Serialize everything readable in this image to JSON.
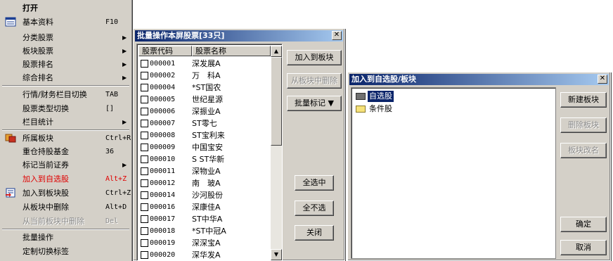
{
  "context_menu": {
    "items": [
      {
        "label": "打开",
        "shortcut": "",
        "submenu": false,
        "style": "bold",
        "icon": ""
      },
      {
        "label": "基本资料",
        "shortcut": "F10",
        "submenu": false,
        "style": "normal",
        "icon": "info-table-icon"
      },
      {
        "label": "分类股票",
        "shortcut": "",
        "submenu": true,
        "style": "normal",
        "icon": ""
      },
      {
        "label": "板块股票",
        "shortcut": "",
        "submenu": true,
        "style": "normal",
        "icon": ""
      },
      {
        "label": "股票排名",
        "shortcut": "",
        "submenu": true,
        "style": "normal",
        "icon": ""
      },
      {
        "label": "综合排名",
        "shortcut": "",
        "submenu": true,
        "style": "normal",
        "icon": ""
      },
      {
        "label": "行情/财务栏目切换",
        "shortcut": "TAB",
        "submenu": false,
        "style": "normal",
        "icon": ""
      },
      {
        "label": "股票类型切换",
        "shortcut": "[]",
        "submenu": false,
        "style": "normal",
        "icon": ""
      },
      {
        "label": "栏目统计",
        "shortcut": "",
        "submenu": true,
        "style": "normal",
        "icon": ""
      },
      {
        "label": "所属板块",
        "shortcut": "Ctrl+R",
        "submenu": false,
        "style": "normal",
        "icon": "sector-icon"
      },
      {
        "label": "重仓持股基金",
        "shortcut": "36",
        "submenu": false,
        "style": "normal",
        "icon": ""
      },
      {
        "label": "标记当前证券",
        "shortcut": "",
        "submenu": true,
        "style": "normal",
        "icon": ""
      },
      {
        "label": "加入到自选股",
        "shortcut": "Alt+Z",
        "submenu": false,
        "style": "red",
        "icon": ""
      },
      {
        "label": "加入到板块股",
        "shortcut": "Ctrl+Z",
        "submenu": false,
        "style": "normal",
        "icon": "add-to-sector-icon"
      },
      {
        "label": "从板块中删除",
        "shortcut": "Alt+D",
        "submenu": false,
        "style": "normal",
        "icon": ""
      },
      {
        "label": "从当前板块中删除",
        "shortcut": "Del",
        "submenu": false,
        "style": "disabled",
        "icon": ""
      },
      {
        "label": "批量操作",
        "shortcut": "",
        "submenu": false,
        "style": "normal",
        "icon": ""
      },
      {
        "label": "定制切换标签",
        "shortcut": "",
        "submenu": false,
        "style": "normal",
        "icon": ""
      }
    ]
  },
  "batch_dialog": {
    "title": "批量操作本屏股票[33只]",
    "close": "✕",
    "columns": [
      "股票代码",
      "股票名称"
    ],
    "rows": [
      {
        "code": "000001",
        "name": "深发展A"
      },
      {
        "code": "000002",
        "name": "万　科A"
      },
      {
        "code": "000004",
        "name": "*ST国农"
      },
      {
        "code": "000005",
        "name": "世纪星源"
      },
      {
        "code": "000006",
        "name": "深振业A"
      },
      {
        "code": "000007",
        "name": "ST零七"
      },
      {
        "code": "000008",
        "name": "ST宝利来"
      },
      {
        "code": "000009",
        "name": "中国宝安"
      },
      {
        "code": "000010",
        "name": "S ST华新"
      },
      {
        "code": "000011",
        "name": "深物业A"
      },
      {
        "code": "000012",
        "name": "南　玻A"
      },
      {
        "code": "000014",
        "name": "沙河股份"
      },
      {
        "code": "000016",
        "name": "深康佳A"
      },
      {
        "code": "000017",
        "name": "ST中华A"
      },
      {
        "code": "000018",
        "name": "*ST中冠A"
      },
      {
        "code": "000019",
        "name": "深深宝A"
      },
      {
        "code": "000020",
        "name": "深华发A"
      }
    ],
    "buttons": {
      "add_to_sector": "加入到板块",
      "remove_from_sector": "从板块中删除",
      "batch_mark": "批量标记 ▼",
      "select_all": "全选中",
      "select_none": "全不选",
      "close": "关闭"
    }
  },
  "add_dialog": {
    "title": "加入到自选股/板块",
    "close": "✕",
    "tree": [
      "自选股",
      "条件股"
    ],
    "selected_index": 0,
    "buttons": {
      "new_sector": "新建板块",
      "delete_sector": "删除板块",
      "rename_sector": "板块改名",
      "ok": "确定",
      "cancel": "取消"
    }
  }
}
